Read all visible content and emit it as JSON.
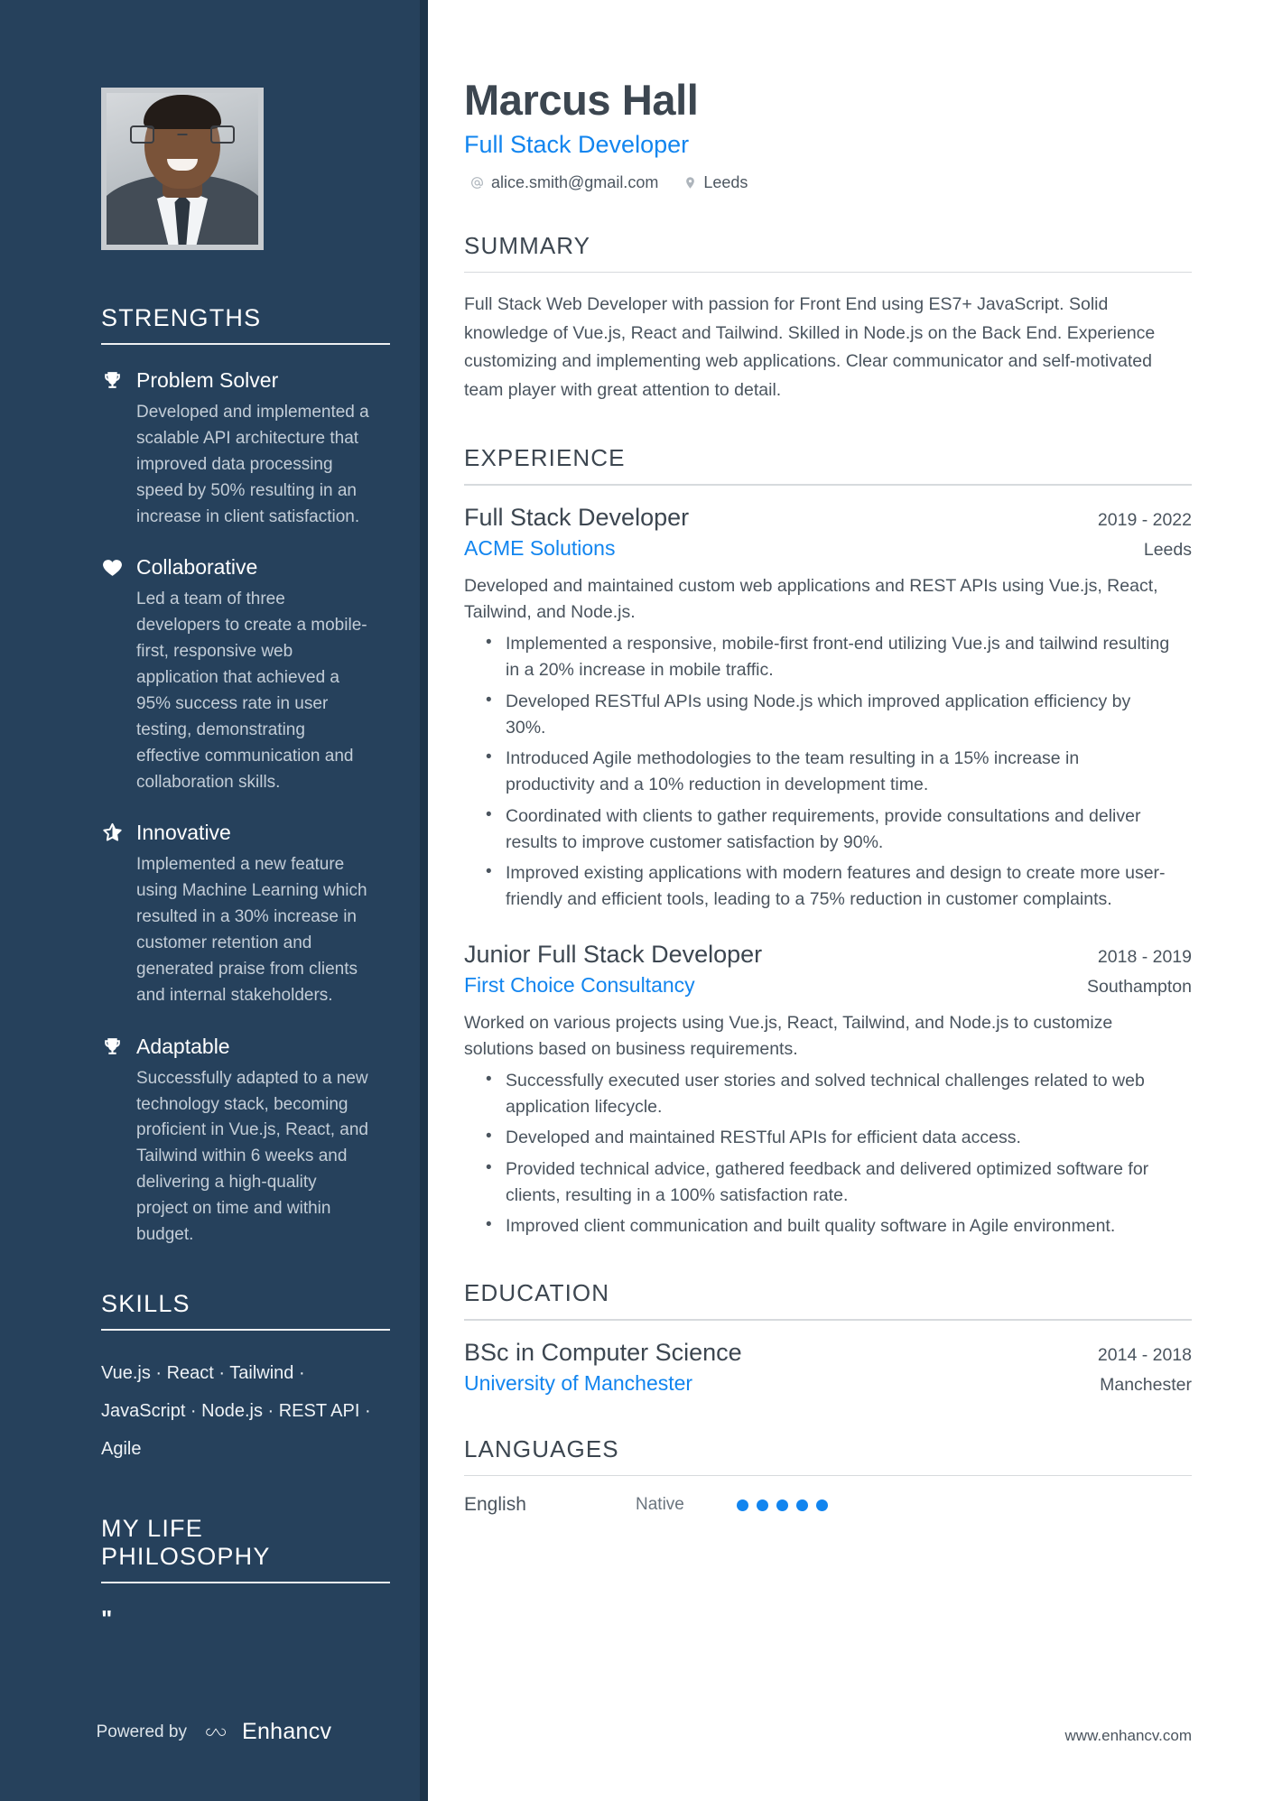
{
  "header": {
    "name": "Marcus Hall",
    "role": "Full Stack Developer",
    "email": "alice.smith@gmail.com",
    "location": "Leeds",
    "email_icon": "at-icon",
    "location_icon": "map-pin-icon"
  },
  "sidebar": {
    "strengths_heading": "STRENGTHS",
    "strengths": [
      {
        "icon": "trophy-icon",
        "title": "Problem Solver",
        "description": "Developed and implemented a scalable API architecture that improved data processing speed by 50% resulting in an increase in client satisfaction."
      },
      {
        "icon": "heart-icon",
        "title": "Collaborative",
        "description": "Led a team of three developers to create a mobile-first, responsive web application that achieved a 95% success rate in user testing, demonstrating effective communication and collaboration skills."
      },
      {
        "icon": "star-half-icon",
        "title": "Innovative",
        "description": "Implemented a new feature using Machine Learning which resulted in a 30% increase in customer retention and generated praise from clients and internal stakeholders."
      },
      {
        "icon": "trophy-icon",
        "title": "Adaptable",
        "description": "Successfully adapted to a new technology stack, becoming proficient in Vue.js, React, and Tailwind within 6 weeks and delivering a high-quality project on time and within budget."
      }
    ],
    "skills_heading": "SKILLS",
    "skills_text": "Vue.js · React · Tailwind · JavaScript · Node.js · REST API · Agile",
    "skills_list": [
      "Vue.js",
      "React",
      "Tailwind",
      "JavaScript",
      "Node.js",
      "REST API",
      "Agile"
    ],
    "philosophy_heading": "MY LIFE PHILOSOPHY",
    "philosophy_quote": "\"",
    "powered_by_label": "Powered by",
    "powered_by_name": "Enhancv"
  },
  "main": {
    "summary": {
      "heading": "SUMMARY",
      "text": "Full Stack Web Developer with passion for Front End using ES7+ JavaScript. Solid knowledge of Vue.js, React and Tailwind. Skilled in Node.js on the Back End. Experience customizing and implementing web applications. Clear communicator and self-motivated team player with great attention to detail."
    },
    "experience": {
      "heading": "EXPERIENCE",
      "entries": [
        {
          "title": "Full Stack Developer",
          "date": "2019 - 2022",
          "organization": "ACME Solutions",
          "location": "Leeds",
          "description": "Developed and maintained custom web applications and REST APIs using Vue.js, React, Tailwind, and Node.js.",
          "bullets": [
            "Implemented a responsive, mobile-first front-end utilizing Vue.js and tailwind resulting in a 20% increase in mobile traffic.",
            "Developed RESTful APIs using Node.js which improved application efficiency by 30%.",
            "Introduced Agile methodologies to the team resulting in a 15% increase in productivity and a 10% reduction in development time.",
            "Coordinated with clients to gather requirements, provide consultations and deliver results to improve customer satisfaction by 90%.",
            "Improved existing applications with modern features and design to create more user-friendly and efficient tools, leading to a 75% reduction in customer complaints."
          ]
        },
        {
          "title": "Junior Full Stack Developer",
          "date": "2018 - 2019",
          "organization": "First Choice Consultancy",
          "location": "Southampton",
          "description": "Worked on various projects using Vue.js, React, Tailwind, and Node.js to customize solutions based on business requirements.",
          "bullets": [
            "Successfully executed user stories and solved technical challenges related to web application lifecycle.",
            "Developed and maintained RESTful APIs for efficient data access.",
            "Provided technical advice, gathered feedback and delivered optimized software for clients, resulting in a 100% satisfaction rate.",
            "Improved client communication and built quality software in Agile environment."
          ]
        }
      ]
    },
    "education": {
      "heading": "EDUCATION",
      "entries": [
        {
          "title": "BSc in Computer Science",
          "date": "2014 - 2018",
          "organization": "University of Manchester",
          "location": "Manchester"
        }
      ]
    },
    "languages": {
      "heading": "LANGUAGES",
      "entries": [
        {
          "name": "English",
          "level": "Native",
          "filled": 5,
          "total": 5
        }
      ]
    },
    "website": "www.enhancv.com"
  },
  "colors": {
    "sidebar_bg": "#26415c",
    "accent_blue": "#1285ef",
    "heading_gray": "#3c4650",
    "body_gray": "#4a545e"
  }
}
